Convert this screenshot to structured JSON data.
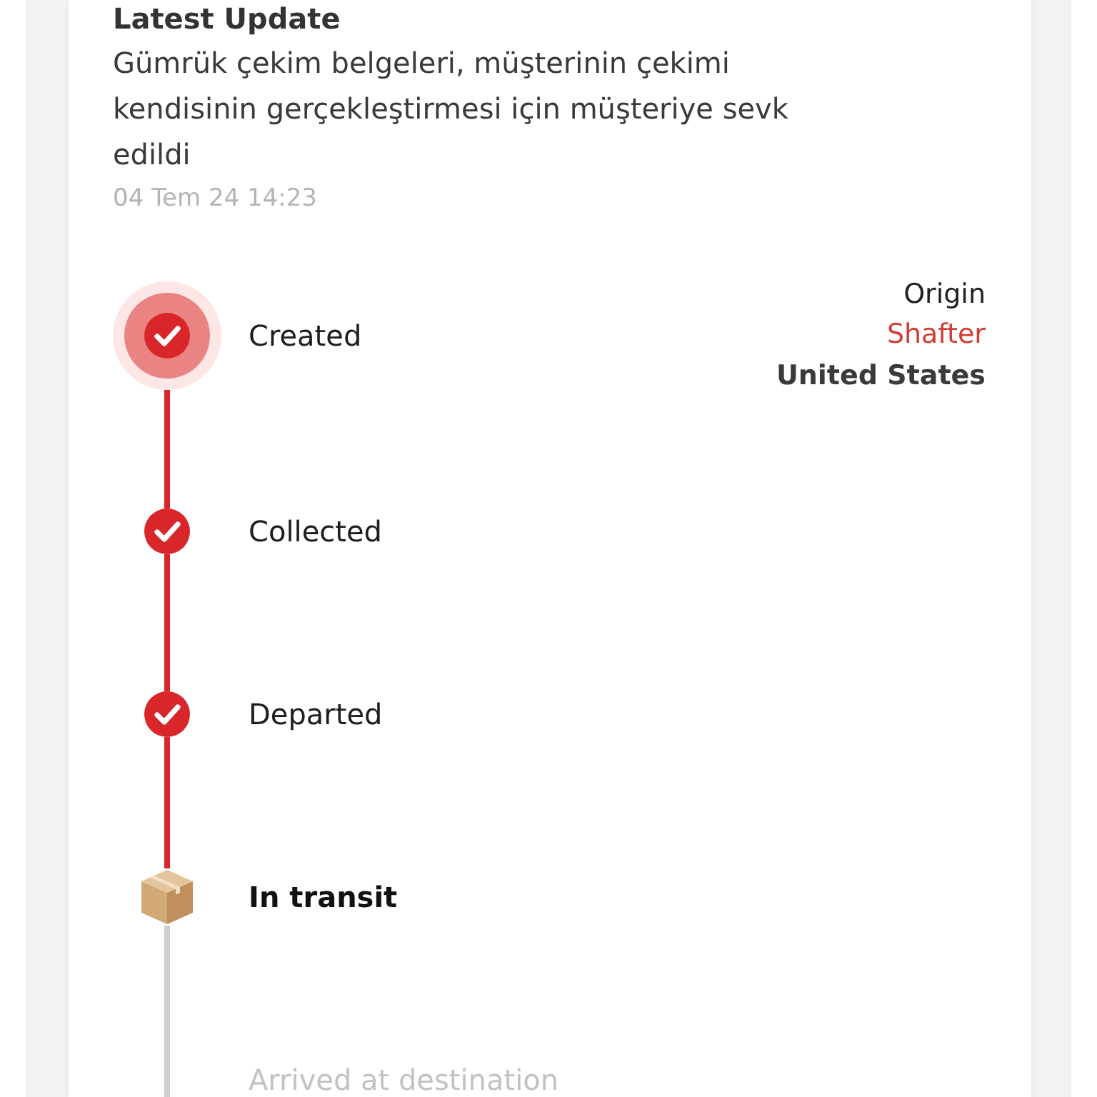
{
  "latest_update": {
    "title": "Latest Update",
    "message": "Gümrük çekim belgeleri, müşterinin çekimi kendisinin gerçekleştirmesi için müşteriye sevk edildi",
    "timestamp": "04 Tem 24 14:23"
  },
  "timeline": {
    "steps": [
      {
        "label": "Created",
        "kind": "origin",
        "location": {
          "caption": "Origin",
          "city": "Shafter",
          "country": "United States"
        }
      },
      {
        "label": "Collected",
        "kind": "done"
      },
      {
        "label": "Departed",
        "kind": "done"
      },
      {
        "label": "In transit",
        "kind": "current"
      },
      {
        "label": "Arrived at destination",
        "kind": "pending"
      }
    ]
  }
}
